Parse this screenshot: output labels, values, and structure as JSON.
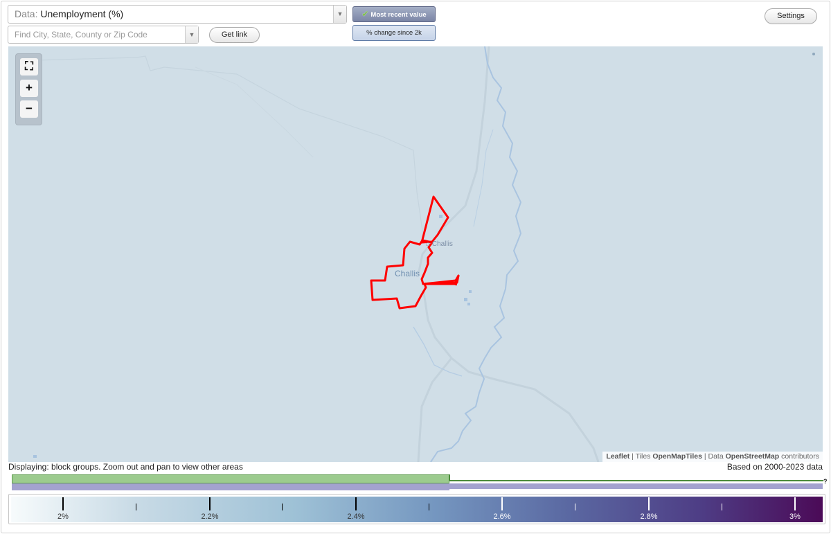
{
  "header": {
    "data_prefix": "Data:",
    "data_value": "Unemployment (%)",
    "search_placeholder": "Find City, State, County or Zip Code",
    "get_link": "Get link",
    "mode_recent": "Most recent value",
    "mode_change": "% change since 2k",
    "settings": "Settings"
  },
  "map": {
    "labels": {
      "town_icon_label": "Challis",
      "town_label": "Challis"
    },
    "attribution": {
      "leaflet": "Leaflet",
      "sep1": "|",
      "tiles_prefix": "Tiles",
      "tiles": "OpenMapTiles",
      "sep2": "|",
      "data_prefix": "Data",
      "osm": "OpenStreetMap",
      "suffix": "contributors"
    },
    "zoom": {
      "fullscreen": "⛶",
      "in": "+",
      "out": "−"
    },
    "colors": {
      "boundary": "#ff0000",
      "water": "#a7c3df",
      "roads": "#c3d2dc"
    }
  },
  "footer": {
    "displaying": "Displaying: block groups. Zoom out and pan to view other areas",
    "based_on": "Based on 2000-2023 data",
    "hist_help": "?"
  },
  "legend": {
    "labels": [
      "2%",
      "2.2%",
      "2.4%",
      "2.6%",
      "2.8%",
      "3%"
    ]
  }
}
